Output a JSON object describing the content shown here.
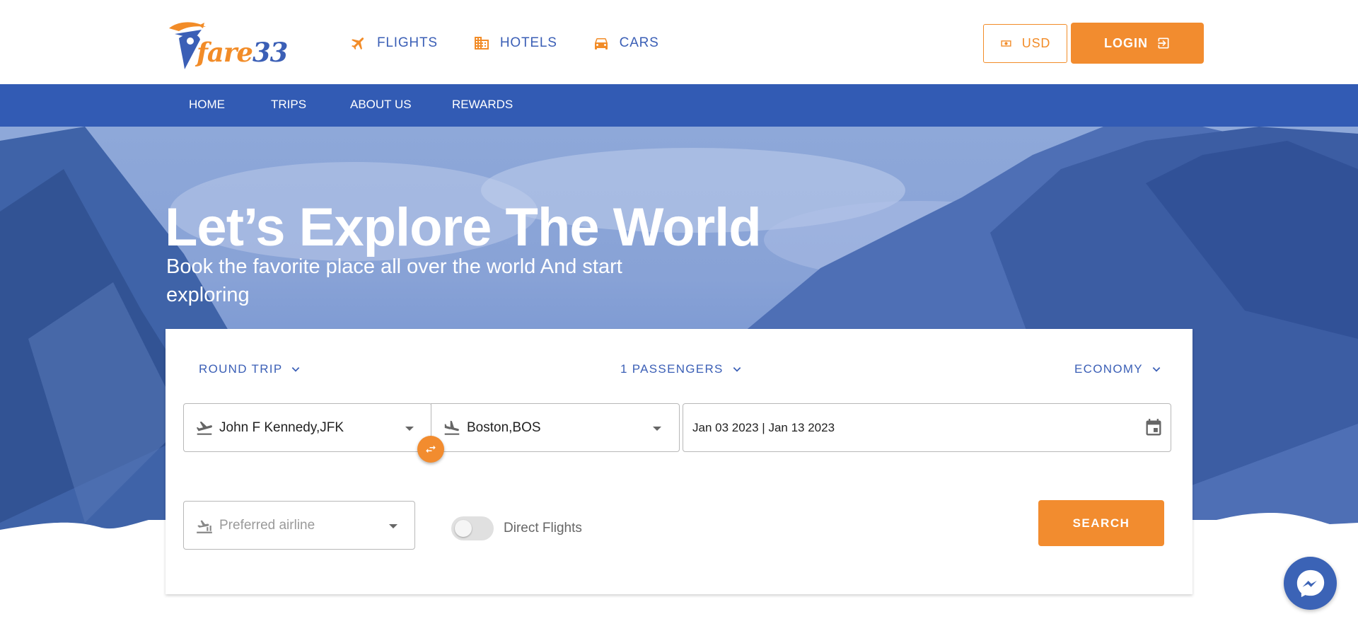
{
  "header": {
    "logo_text_f": "fare",
    "logo_text_n": "33",
    "nav": [
      {
        "label": "FLIGHTS",
        "icon": "plane-icon"
      },
      {
        "label": "HOTELS",
        "icon": "building-icon"
      },
      {
        "label": "CARS",
        "icon": "car-icon"
      }
    ],
    "currency_label": "USD",
    "login_label": "LOGIN"
  },
  "menu": {
    "items": [
      "HOME",
      "TRIPS",
      "ABOUT US",
      "REWARDS"
    ]
  },
  "hero": {
    "title": "Let’s Explore The World",
    "subtitle": "Book the favorite place all over the world And start exploring"
  },
  "search": {
    "trip_type": "ROUND TRIP",
    "passengers": "1 PASSENGERS",
    "cabin": "ECONOMY",
    "from": "John F Kennedy,JFK",
    "to": "Boston,BOS",
    "dates": "Jan 03 2023 | Jan 13 2023",
    "airline_placeholder": "Preferred airline",
    "direct_label": "Direct Flights",
    "direct_on": false,
    "button_label": "SEARCH"
  },
  "colors": {
    "brand_blue": "#325bb4",
    "brand_orange": "#f28c2f",
    "text_blue": "#3b5fb6"
  }
}
